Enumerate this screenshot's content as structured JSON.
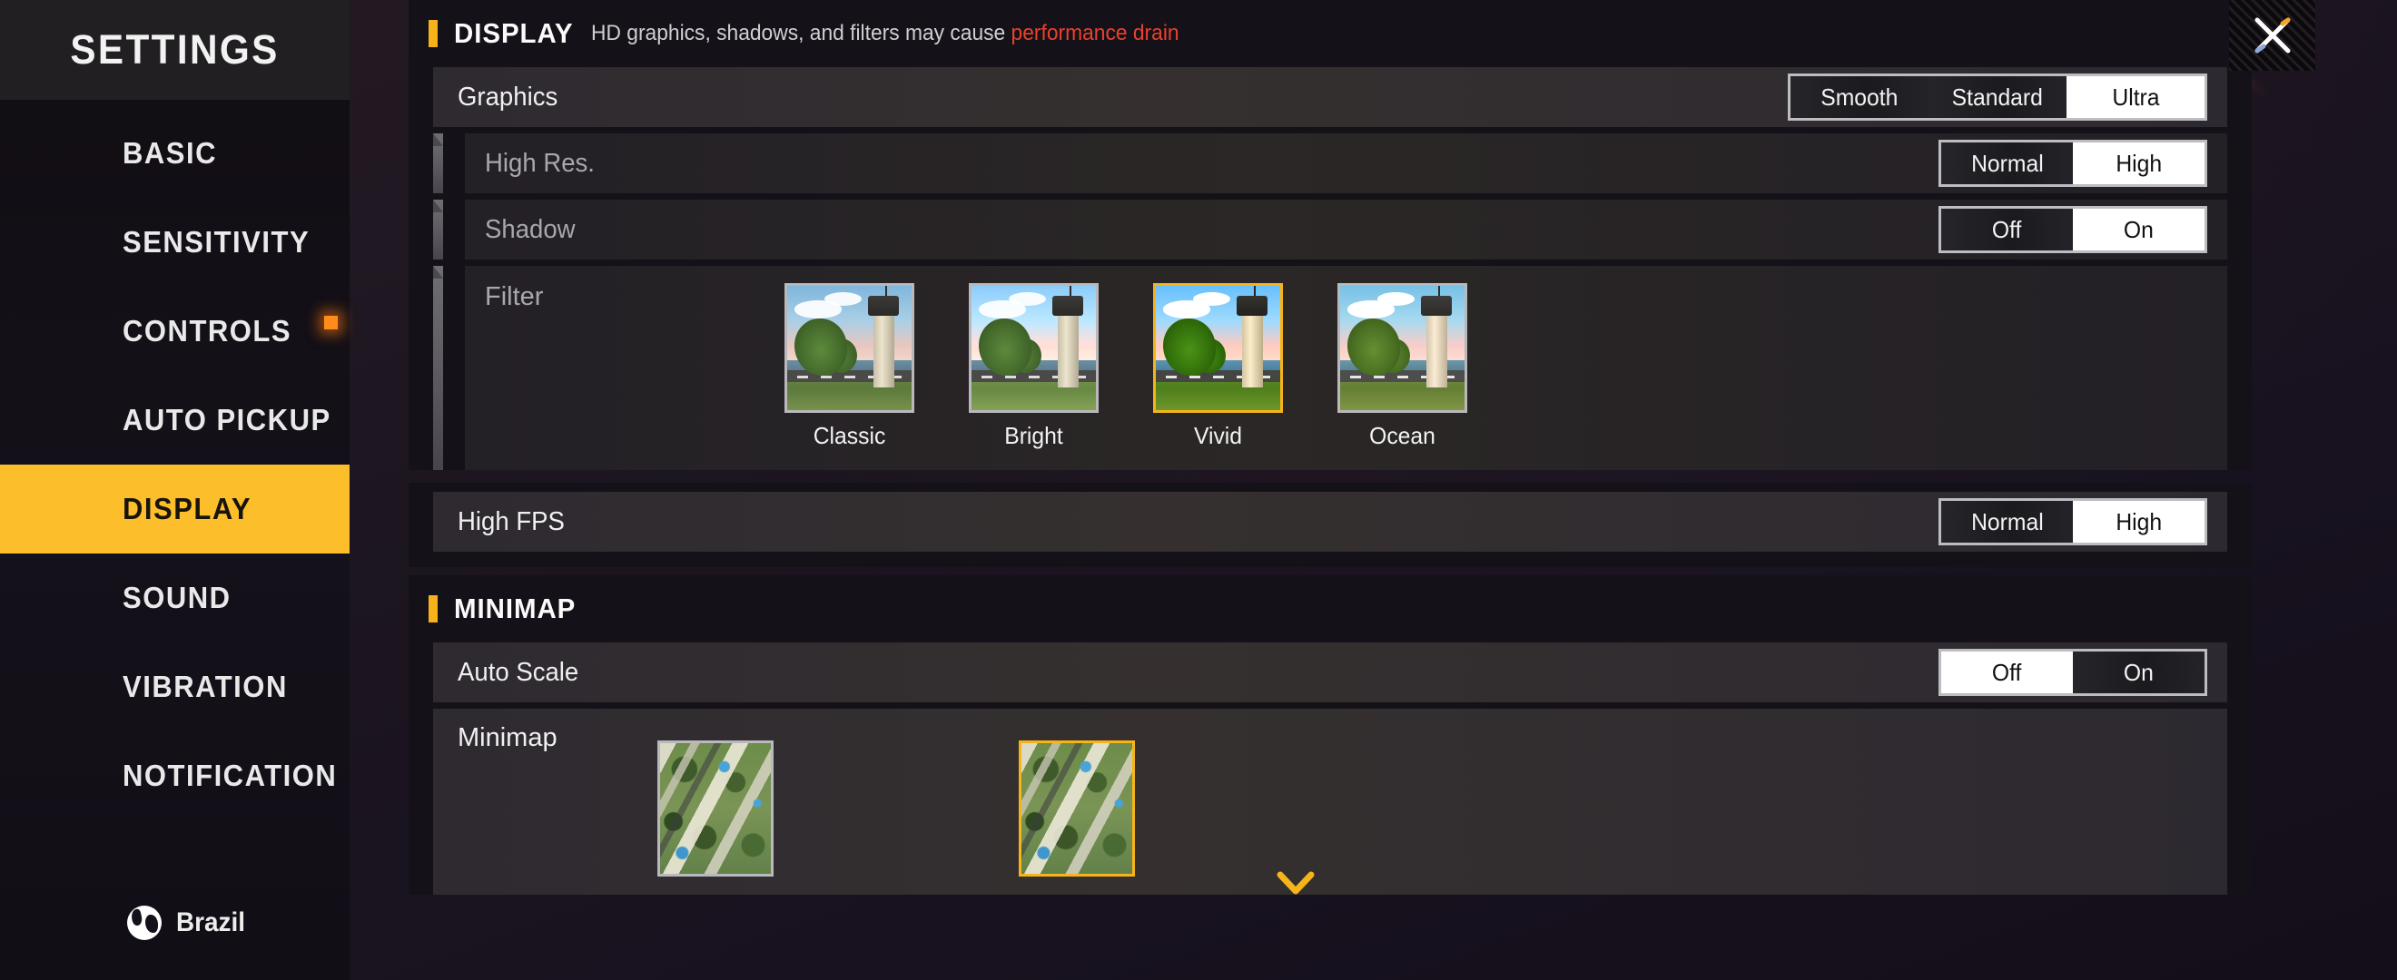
{
  "app": {
    "title": "SETTINGS",
    "accent_yellow": "#fcbe2b",
    "accent_orange": "#f7b219",
    "warn_red": "#e8412f",
    "background": "#1d1620"
  },
  "sidebar": {
    "header_title": "SETTINGS",
    "items": [
      {
        "label": "BASIC",
        "active": false,
        "badge": false
      },
      {
        "label": "SENSITIVITY",
        "active": false,
        "badge": false
      },
      {
        "label": "CONTROLS",
        "active": false,
        "badge": true
      },
      {
        "label": "AUTO PICKUP",
        "active": false,
        "badge": false
      },
      {
        "label": "DISPLAY",
        "active": true,
        "badge": false
      },
      {
        "label": "SOUND",
        "active": false,
        "badge": false
      },
      {
        "label": "VIBRATION",
        "active": false,
        "badge": false
      },
      {
        "label": "NOTIFICATION",
        "active": false,
        "badge": false
      }
    ],
    "locale": {
      "icon": "globe-icon",
      "name": "Brazil"
    }
  },
  "close_button": {
    "icon": "close-icon",
    "label": "Close"
  },
  "display_section": {
    "title": "DISPLAY",
    "note_prefix": "HD graphics, shadows, and filters may cause ",
    "note_warning": "performance drain",
    "graphics": {
      "label": "Graphics",
      "options": [
        "Smooth",
        "Standard",
        "Ultra"
      ],
      "selected": "Ultra"
    },
    "high_res": {
      "label": "High Res.",
      "options": [
        "Normal",
        "High"
      ],
      "selected": "High"
    },
    "shadow": {
      "label": "Shadow",
      "options": [
        "Off",
        "On"
      ],
      "selected": "On"
    },
    "filter": {
      "label": "Filter",
      "items": [
        {
          "name": "Classic",
          "selected": false,
          "style": "classic"
        },
        {
          "name": "Bright",
          "selected": false,
          "style": "bright"
        },
        {
          "name": "Vivid",
          "selected": true,
          "style": "vivid"
        },
        {
          "name": "Ocean",
          "selected": false,
          "style": "ocean"
        }
      ]
    }
  },
  "high_fps": {
    "label": "High FPS",
    "options": [
      "Normal",
      "High"
    ],
    "selected": "High"
  },
  "minimap_section": {
    "title": "MINIMAP",
    "auto_scale": {
      "label": "Auto Scale",
      "options": [
        "Off",
        "On"
      ],
      "selected": "Off"
    },
    "minimap": {
      "label": "Minimap",
      "items": [
        {
          "selected": false
        },
        {
          "selected": true
        }
      ]
    }
  },
  "scroll_indicator": {
    "icon": "chevron-down-icon"
  }
}
